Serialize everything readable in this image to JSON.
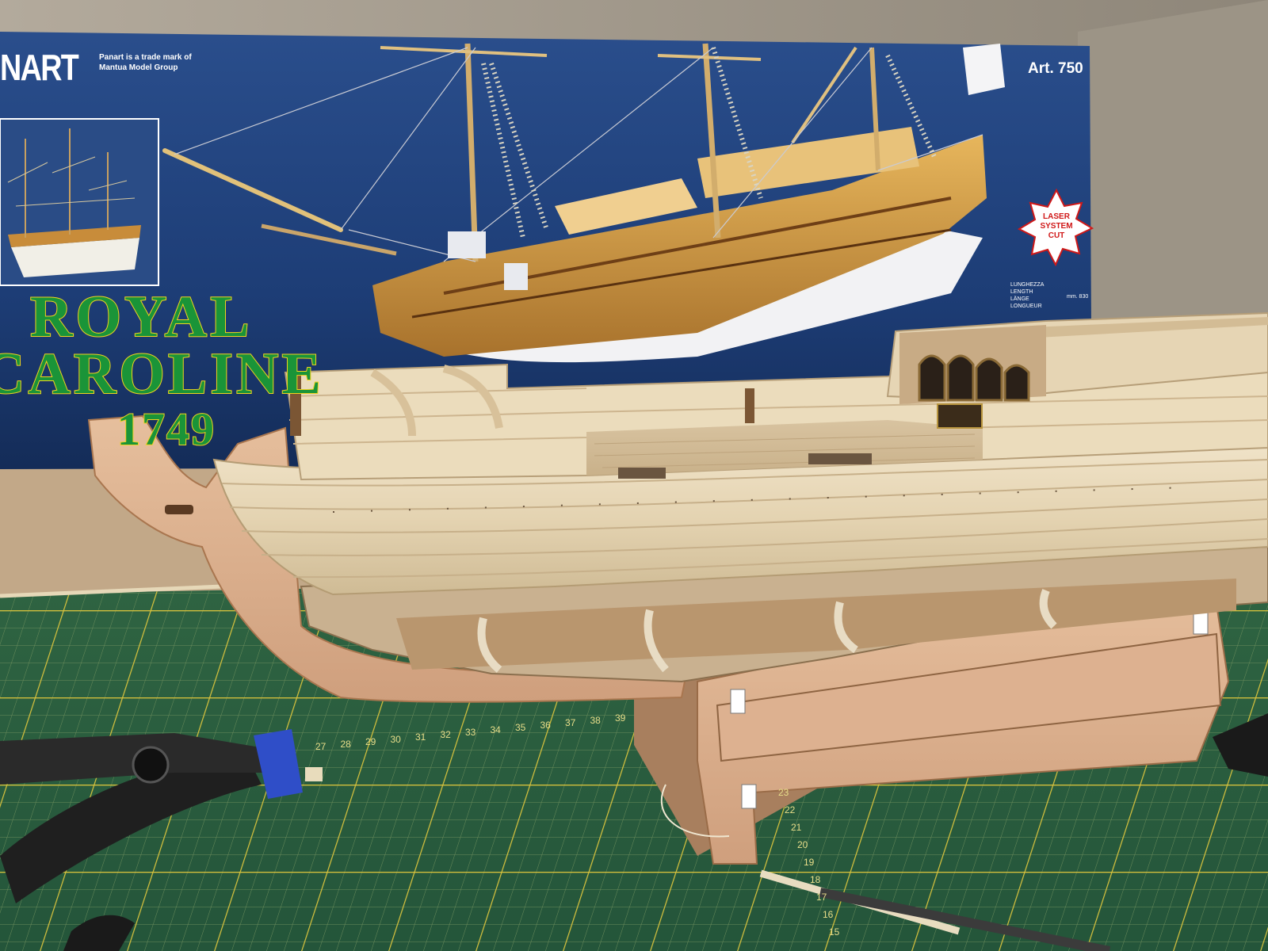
{
  "box": {
    "brand": "NART",
    "trademark": "Panart is a trade mark of\nMantua Model Group",
    "article": "Art. 750",
    "title_line1": "ROYAL",
    "title_line2": "CAROLINE",
    "title_line3": "1749",
    "badge": "LASER\nSYSTEM\nCUT",
    "length_labels": "LUNGHEZZA\nLENGTH\nLÄNGE\nLONGUEUR",
    "length_value": "mm. 830"
  },
  "mat": {
    "top_ruler": [
      "27",
      "28",
      "29",
      "30",
      "31",
      "32",
      "33",
      "34",
      "35",
      "36",
      "37",
      "38",
      "39"
    ],
    "side_ruler": [
      "23",
      "22",
      "21",
      "20",
      "19",
      "18",
      "17",
      "16",
      "15"
    ]
  },
  "colors": {
    "box_blue": "#1d3d76",
    "mat_green": "#2b5e3d",
    "grid_yellow": "#c9b23a",
    "title_green": "#1a9438",
    "title_outline": "#f2d21e",
    "hull_wood": "#e4d4b4",
    "plywood": "#d9a987",
    "clamp_black": "#1f1f1f",
    "clamp_blue": "#2f4ec8"
  }
}
